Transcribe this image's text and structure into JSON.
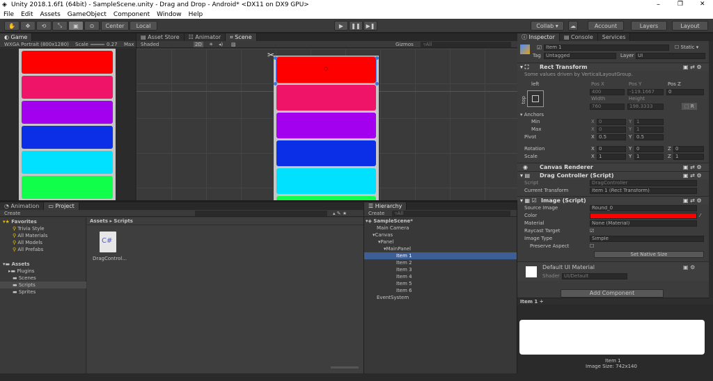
{
  "window": {
    "title": "Unity 2018.1.6f1 (64bit) - SampleScene.unity - Drag and Drop - Android* <DX11 on DX9 GPU>",
    "controls": [
      "–",
      "❐",
      "✕"
    ]
  },
  "menu": [
    "File",
    "Edit",
    "Assets",
    "GameObject",
    "Component",
    "Window",
    "Help"
  ],
  "toolbar": {
    "tools": [
      "✋",
      "✥",
      "⟲",
      "⤡",
      "▣",
      "⊙"
    ],
    "center": "Center",
    "local": "Local",
    "play": "▶",
    "pause": "❚❚",
    "step": "▶❚",
    "collab": "Collab ▾",
    "account": "Account",
    "layers": "Layers",
    "layout": "Layout"
  },
  "game": {
    "tab": "Game",
    "resolution": "WXGA Portrait (800x1280)",
    "scale_label": "Scale",
    "scale_value": "0.27",
    "max": "Max"
  },
  "mid_tabs": {
    "asset_store": "Asset Store",
    "animator": "Animator",
    "scene": "Scene"
  },
  "scene": {
    "shaded": "Shaded",
    "mode_2d": "2D",
    "gizmos": "Gizmos",
    "search_placeholder": "▿All"
  },
  "item_colors": [
    "#ff0000",
    "#ef1468",
    "#a200ef",
    "#0a2fe6",
    "#00e0ff",
    "#10ff4a"
  ],
  "project": {
    "tabs": {
      "animation": "Animation",
      "project": "Project"
    },
    "create": "Create",
    "favorites_label": "Favorites",
    "favorites": [
      "Trivia Style",
      "All Materials",
      "All Models",
      "All Prefabs"
    ],
    "assets_label": "Assets",
    "folders": [
      "Plugins",
      "Scenes",
      "Scripts",
      "Sprites"
    ],
    "breadcrumb": "Assets ▸ Scripts",
    "file_icon_text": "C#",
    "file_name": "DragControl..."
  },
  "hierarchy": {
    "tab": "Hierarchy",
    "create": "Create",
    "search_placeholder": "▿All",
    "scene": "SampleScene*",
    "nodes": [
      "Main Camera",
      "Canvas",
      "Panel",
      "MainPanel",
      "Item 1",
      "Item 2",
      "Item 3",
      "Item 4",
      "Item 5",
      "Item 6",
      "EventSystem"
    ]
  },
  "inspector": {
    "tabs": {
      "inspector": "Inspector",
      "console": "Console",
      "services": "Services"
    },
    "object_name": "Item 1",
    "static_label": "Static",
    "tag_label": "Tag",
    "tag_value": "Untagged",
    "layer_label": "Layer",
    "layer_value": "UI",
    "rect_transform": {
      "title": "Rect Transform",
      "note": "Some values driven by VerticalLayoutGroup.",
      "anchor_h": "left",
      "anchor_v": "top",
      "pos_x_label": "Pos X",
      "pos_y_label": "Pos Y",
      "pos_z_label": "Pos Z",
      "pos_x": "400",
      "pos_y": "-119.1667",
      "pos_z": "0",
      "width_label": "Width",
      "height_label": "Height",
      "width": "760",
      "height": "198.3333",
      "r_button": "R",
      "anchors": "Anchors",
      "min": "Min",
      "max": "Max",
      "min_x": "0",
      "min_y": "1",
      "max_x": "0",
      "max_y": "1",
      "pivot": "Pivot",
      "pivot_x": "0.5",
      "pivot_y": "0.5",
      "rotation": "Rotation",
      "rot_x": "0",
      "rot_y": "0",
      "rot_z": "0",
      "scale": "Scale",
      "scale_x": "1",
      "scale_y": "1",
      "scale_z": "1",
      "x": "X",
      "y": "Y",
      "z": "Z"
    },
    "canvas_renderer": "Canvas Renderer",
    "drag_controller": {
      "title": "Drag Controller (Script)",
      "script_label": "Script",
      "script_value": "DragController",
      "current_label": "Current Transform",
      "current_value": "Item 1 (Rect Transform)"
    },
    "image": {
      "title": "Image (Script)",
      "source_label": "Source Image",
      "source_value": "Round_0",
      "color_label": "Color",
      "color": "#ff0000",
      "material_label": "Material",
      "material_value": "None (Material)",
      "raycast_label": "Raycast Target",
      "type_label": "Image Type",
      "type_value": "Simple",
      "preserve_label": "Preserve Aspect",
      "native_button": "Set Native Size"
    },
    "material": {
      "name": "Default UI Material",
      "shader_label": "Shader",
      "shader_value": "UI/Default"
    },
    "add_component": "Add Component",
    "preview_header": "Item 1 ÷",
    "preview_name": "Item 1",
    "preview_size": "Image Size: 742x140"
  }
}
